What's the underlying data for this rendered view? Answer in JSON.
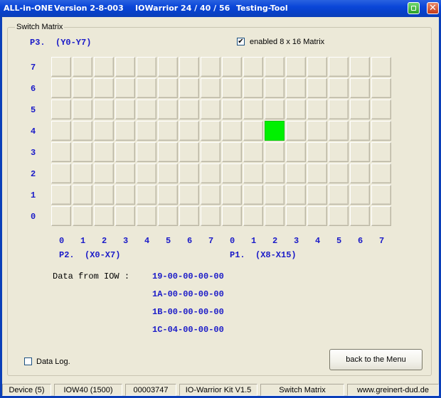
{
  "window": {
    "title_app": "ALL-in-ONE",
    "title_version": "Version 2-8-003",
    "title_device": "IOWarrior 24 / 40 / 56",
    "title_tool": "Testing-Tool"
  },
  "group": {
    "label": "Switch Matrix"
  },
  "ports": {
    "rows_label": "P3.  (Y0-Y7)",
    "cols_left_label": "P2.  (X0-X7)",
    "cols_right_label": "P1.  (X8-X15)"
  },
  "matrix_checkbox": {
    "label": "enabled 8 x 16 Matrix",
    "checked": true,
    "mark": "✔"
  },
  "matrix": {
    "rows": 8,
    "cols": 16,
    "row_labels": [
      "7",
      "6",
      "5",
      "4",
      "3",
      "2",
      "1",
      "0"
    ],
    "col_labels": [
      "0",
      "1",
      "2",
      "3",
      "4",
      "5",
      "6",
      "7",
      "0",
      "1",
      "2",
      "3",
      "4",
      "5",
      "6",
      "7"
    ],
    "active_cells": [
      {
        "row_label": "4",
        "col_index": 10
      }
    ],
    "active_color": "#00f000"
  },
  "data": {
    "label": "Data from IOW :",
    "lines": [
      "19-00-00-00-00",
      "1A-00-00-00-00",
      "1B-00-00-00-00",
      "1C-04-00-00-00"
    ]
  },
  "datalog": {
    "label": "Data Log.",
    "checked": false
  },
  "back_button": {
    "label": "back to the Menu"
  },
  "statusbar": {
    "device": "Device (5)",
    "model": "IOW40 (1500)",
    "serial": "00003747",
    "kit": "IO-Warrior Kit V1.5",
    "mode": "Switch Matrix",
    "url": "www.greinert-dud.de"
  },
  "colors": {
    "accent_text": "#1a1ac8",
    "titlebar": "#0a46d8"
  }
}
